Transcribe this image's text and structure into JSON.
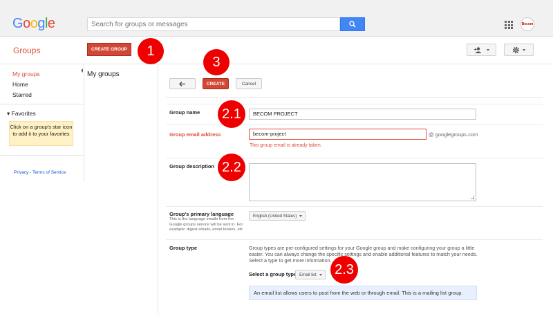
{
  "header": {
    "logo_letters": [
      {
        "char": "G",
        "color": "#4285f4"
      },
      {
        "char": "o",
        "color": "#ea4335"
      },
      {
        "char": "o",
        "color": "#fbbc05"
      },
      {
        "char": "g",
        "color": "#4285f4"
      },
      {
        "char": "l",
        "color": "#34a853"
      },
      {
        "char": "e",
        "color": "#ea4335"
      }
    ],
    "search_placeholder": "Search for groups or messages",
    "search_icon": "search-icon",
    "apps_icon": "apps-grid-icon",
    "avatar_text": "Becom"
  },
  "toolbar": {
    "section_title": "Groups",
    "create_group_label": "CREATE GROUP"
  },
  "annotations": [
    "1",
    "2.1",
    "2.2",
    "2.3",
    "3"
  ],
  "nav": {
    "items": [
      "My groups",
      "Home",
      "Starred"
    ],
    "favorites_label": "Favorites",
    "favorites_hint": "Click on a group's star icon to add it to your favorites",
    "footer": "Privacy - Terms of Service"
  },
  "main": {
    "heading": "My groups"
  },
  "form": {
    "back_icon": "back-arrow-icon",
    "create_label": "CREATE",
    "cancel_label": "Cancel",
    "group_name_label": "Group name",
    "group_name_value": "BECOM PROJECT",
    "email_label": "Group email address",
    "email_value": "becom-project",
    "email_suffix": "@ googlegroups.com",
    "email_error": "This group email is already taken.",
    "description_label": "Group description",
    "language_label": "Group's primary language",
    "language_help": "This is the language emails from the Google groups service will be sent in. For example: digest emails, email footers, etc",
    "language_value": "English (United States)",
    "group_type_label": "Group type",
    "group_type_desc": "Group types are pre-configured settings for your Google group and make configuring your group a little easier. You can always change the specific settings and enable additional features to match your needs. Select a type to get more information.",
    "select_type_label": "Select a group type",
    "select_type_value": "Email list",
    "type_info": "An email list allows users to post from the web or through email. This is a mailing list group."
  }
}
